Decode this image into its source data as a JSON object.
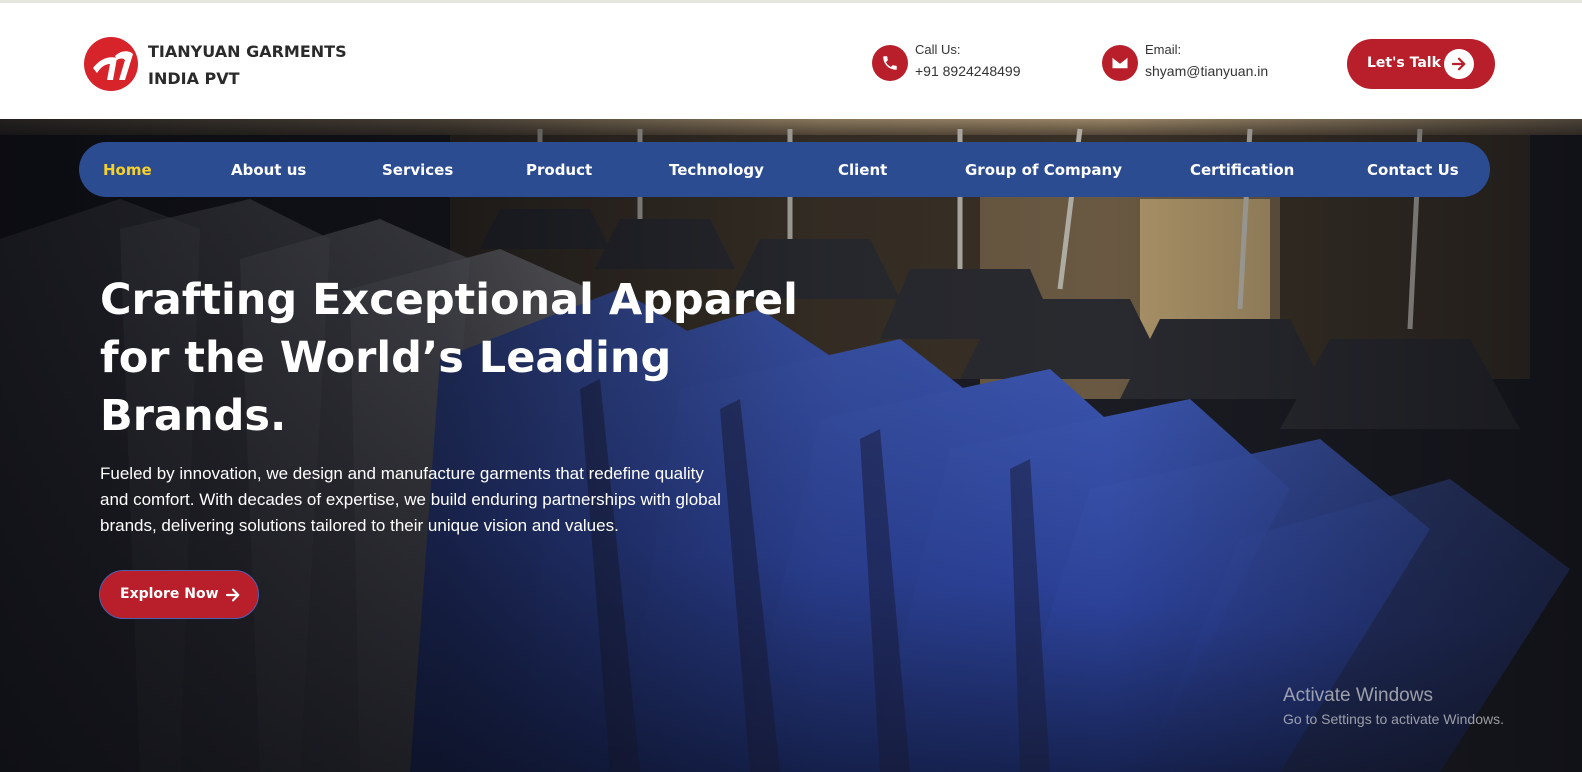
{
  "header": {
    "brand_line1": "TIANYUAN GARMENTS",
    "brand_line2": "INDIA PVT",
    "call_label": "Call Us:",
    "call_value": "+91 8924248499",
    "email_label": "Email:",
    "email_value": "shyam@tianyuan.in",
    "cta_label": "Let's Talk",
    "icons": {
      "logo": "tianyuan-logo",
      "phone": "phone-icon",
      "email": "envelope-icon",
      "cta": "arrow-right-icon"
    }
  },
  "nav": {
    "items": [
      {
        "label": "Home",
        "active": true
      },
      {
        "label": "About us"
      },
      {
        "label": "Services"
      },
      {
        "label": "Product"
      },
      {
        "label": "Technology"
      },
      {
        "label": "Client"
      },
      {
        "label": "Group of Company"
      },
      {
        "label": "Certification"
      },
      {
        "label": "Contact Us"
      }
    ]
  },
  "hero": {
    "headline_lines": [
      "Crafting Exceptional Apparel",
      "for the World’s Leading",
      "Brands."
    ],
    "lead_lines": [
      "Fueled by innovation, we design and manufacture garments that redefine quality",
      "and comfort. With decades of expertise, we build enduring partnerships with global",
      "brands, delivering solutions tailored to their unique vision and values."
    ],
    "cta_label": "Explore Now"
  },
  "watermark": {
    "line1": "Activate Windows",
    "line2": "Go to Settings to activate Windows."
  },
  "colors": {
    "accent_red": "#b81f2a",
    "nav_blue": "#2c4c91",
    "nav_active": "#f6d02b"
  }
}
